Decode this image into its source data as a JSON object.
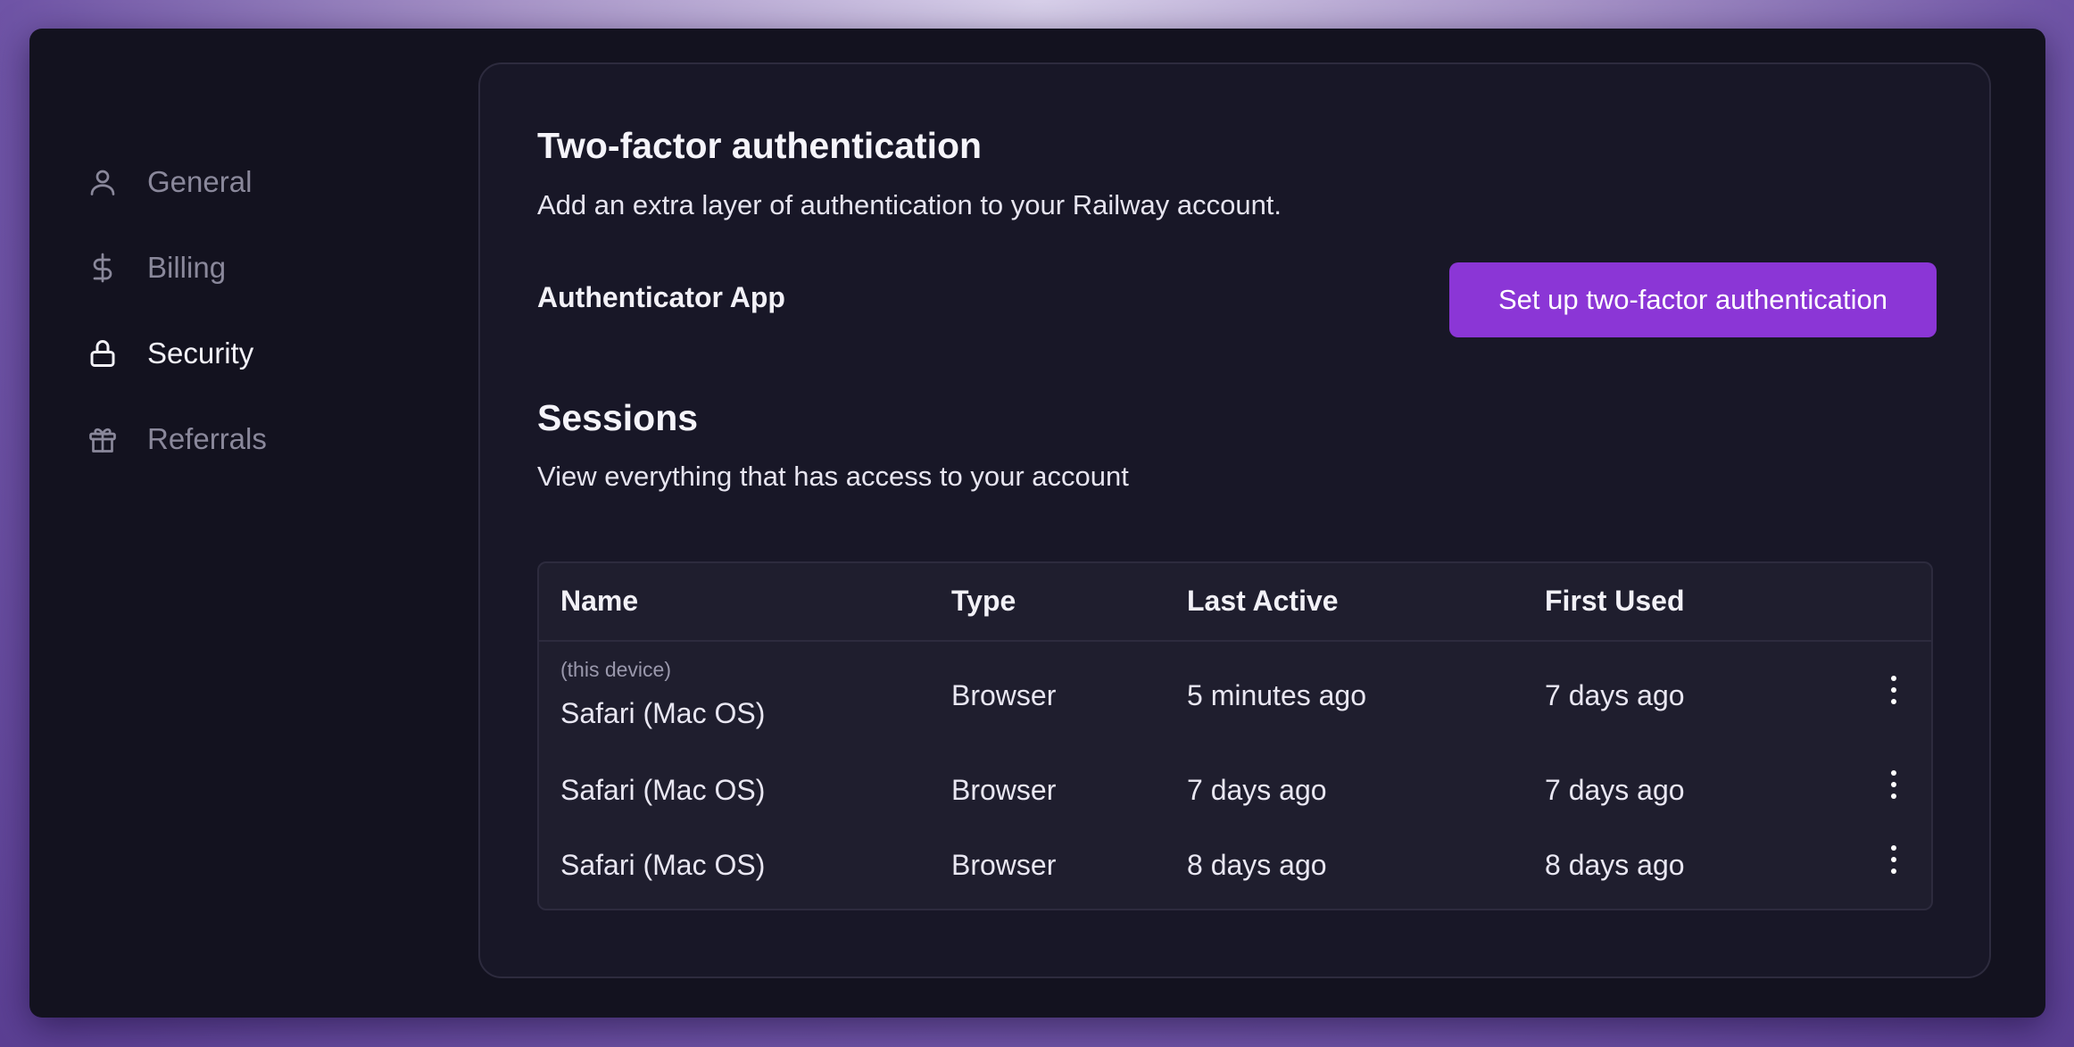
{
  "sidebar": {
    "items": [
      {
        "label": "General",
        "icon": "user-icon"
      },
      {
        "label": "Billing",
        "icon": "dollar-icon"
      },
      {
        "label": "Security",
        "icon": "lock-icon",
        "active": true
      },
      {
        "label": "Referrals",
        "icon": "gift-icon"
      }
    ]
  },
  "twofa": {
    "title": "Two-factor authentication",
    "description": "Add an extra layer of authentication to your Railway account.",
    "method_label": "Authenticator App",
    "button_label": "Set up two-factor authentication"
  },
  "sessions": {
    "title": "Sessions",
    "description": "View everything that has access to your account",
    "columns": [
      "Name",
      "Type",
      "Last Active",
      "First Used"
    ],
    "rows": [
      {
        "note": "(this device)",
        "name": "Safari (Mac OS)",
        "type": "Browser",
        "last_active": "5 minutes ago",
        "first_used": "7 days ago"
      },
      {
        "name": "Safari (Mac OS)",
        "type": "Browser",
        "last_active": "7 days ago",
        "first_used": "7 days ago"
      },
      {
        "name": "Safari (Mac OS)",
        "type": "Browser",
        "last_active": "8 days ago",
        "first_used": "8 days ago"
      }
    ]
  },
  "colors": {
    "accent": "#8b36d6",
    "background": "#13121f",
    "card": "#181727"
  }
}
